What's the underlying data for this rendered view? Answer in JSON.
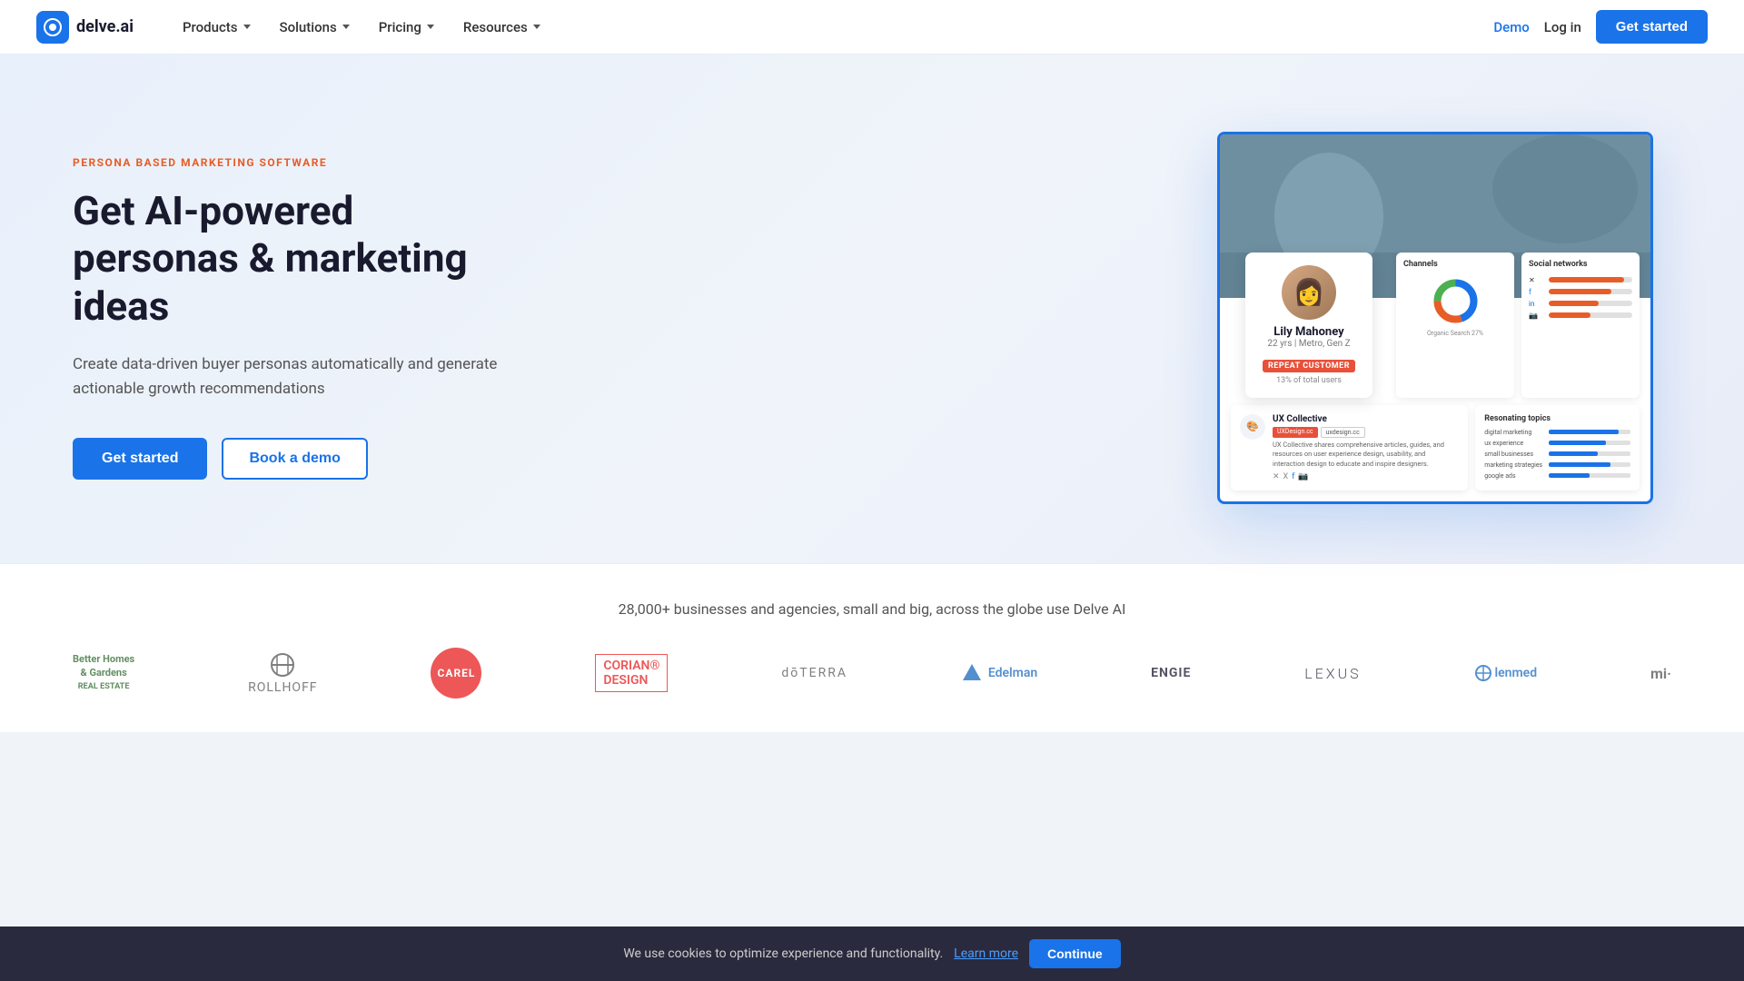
{
  "nav": {
    "logo_text": "delve.ai",
    "links": [
      {
        "label": "Products",
        "has_dropdown": true
      },
      {
        "label": "Solutions",
        "has_dropdown": true
      },
      {
        "label": "Pricing",
        "has_dropdown": true
      },
      {
        "label": "Resources",
        "has_dropdown": true
      }
    ],
    "demo_label": "Demo",
    "login_label": "Log in",
    "cta_label": "Get started"
  },
  "hero": {
    "tag": "PERSONA BASED MARKETING SOFTWARE",
    "title": "Get AI-powered personas & marketing ideas",
    "description": "Create data-driven buyer personas automatically and generate actionable growth recommendations",
    "cta_primary": "Get started",
    "cta_secondary": "Book a demo"
  },
  "persona_card": {
    "name": "Lily Mahoney",
    "meta": "22 yrs | Metro, Gen Z",
    "badge": "REPEAT CUSTOMER",
    "percent": "13% of total users"
  },
  "dashboard": {
    "channels_title": "Channels",
    "social_title": "Social networks",
    "ux_name": "UX Collective",
    "ux_badge1": "UXDesign.cc",
    "ux_badge2": "uxdesign.cc",
    "ux_desc": "UX Collective shares comprehensive articles, guides, and resources on user experience design, usability, and interaction design to educate and inspire designers.",
    "resonating_title": "Resonating topics",
    "resonating_items": [
      {
        "label": "digital marketing",
        "pct": 85
      },
      {
        "label": "ux experience",
        "pct": 70
      },
      {
        "label": "small businesses",
        "pct": 60
      },
      {
        "label": "marketing strategies",
        "pct": 75
      },
      {
        "label": "google ads",
        "pct": 50
      }
    ],
    "social_bars": [
      {
        "label": "X",
        "pct": 90,
        "color": "#e85d26"
      },
      {
        "label": "fb",
        "pct": 75,
        "color": "#e85d26"
      },
      {
        "label": "in",
        "pct": 60,
        "color": "#e85d26"
      },
      {
        "label": "inst",
        "pct": 50,
        "color": "#e85d26"
      }
    ],
    "donut_segments": [
      {
        "color": "#1a73e8",
        "pct": 45
      },
      {
        "color": "#e85d26",
        "pct": 30
      },
      {
        "color": "#e0e0e0",
        "pct": 25
      }
    ]
  },
  "logos": {
    "headline": "28,000+ businesses and agencies, small and big, across the globe use Delve AI",
    "brands": [
      {
        "name": "Better Homes & Gardens Real Estate",
        "style": "better-homes"
      },
      {
        "name": "Rollhoff",
        "style": "rollhoff"
      },
      {
        "name": "CAREL",
        "style": "carel"
      },
      {
        "name": "CORIAN DESIGN",
        "style": "corian"
      },
      {
        "name": "dōTERRA",
        "style": "doterra"
      },
      {
        "name": "Edelman",
        "style": "edelman"
      },
      {
        "name": "ENGIE",
        "style": "engie"
      },
      {
        "name": "LEXUS",
        "style": "lexus"
      },
      {
        "name": "lenmed",
        "style": "lenmed"
      },
      {
        "name": "mi.",
        "style": "mi"
      }
    ]
  },
  "cookie": {
    "message": "We use cookies to optimize experience and functionality.",
    "learn_more": "Learn more",
    "button_label": "Continue"
  }
}
